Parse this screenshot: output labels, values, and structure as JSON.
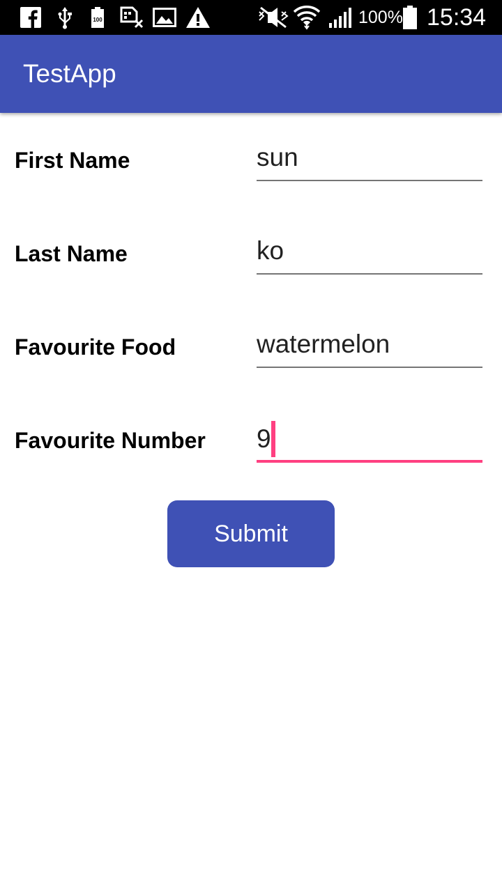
{
  "status_bar": {
    "battery_percent": "100%",
    "time": "15:34",
    "icons": [
      "facebook-icon",
      "usb-icon",
      "battery-saver-icon",
      "sim-error-icon",
      "image-icon",
      "warning-icon",
      "mute-icon",
      "wifi-icon",
      "signal-icon",
      "battery-icon"
    ]
  },
  "app_bar": {
    "title": "TestApp"
  },
  "form": {
    "first_name": {
      "label": "First Name",
      "value": "sun"
    },
    "last_name": {
      "label": "Last Name",
      "value": "ko"
    },
    "favourite_food": {
      "label": "Favourite Food",
      "value": "watermelon"
    },
    "favourite_number": {
      "label": "Favourite Number",
      "value": "9"
    },
    "submit_label": "Submit"
  },
  "colors": {
    "primary": "#3f51b5",
    "accent": "#ff4081",
    "underline": "#757575"
  }
}
